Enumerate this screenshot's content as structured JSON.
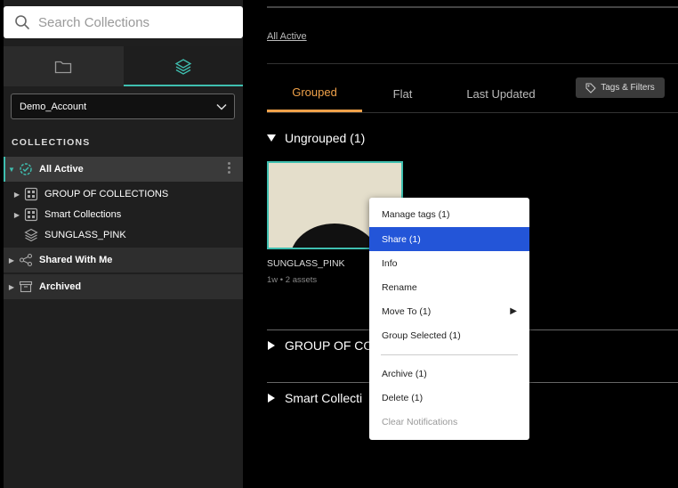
{
  "search": {
    "placeholder": "Search Collections"
  },
  "account": {
    "selected": "Demo_Account"
  },
  "sidebar": {
    "section_label": "COLLECTIONS",
    "items": [
      {
        "label": "All Active"
      },
      {
        "label": "GROUP OF COLLECTIONS"
      },
      {
        "label": "Smart Collections"
      },
      {
        "label": "SUNGLASS_PINK"
      },
      {
        "label": "Shared With Me"
      },
      {
        "label": "Archived"
      }
    ]
  },
  "main": {
    "breadcrumb": "All Active",
    "tabs": [
      {
        "label": "Grouped"
      },
      {
        "label": "Flat"
      },
      {
        "label": "Last Updated"
      }
    ],
    "tags_filters_label": "Tags & Filters",
    "groups": [
      {
        "label": "Ungrouped (1)"
      },
      {
        "label": "GROUP OF CO"
      },
      {
        "label": "Smart Collecti"
      }
    ],
    "card": {
      "title": "SUNGLASS_PINK",
      "age": "1w",
      "assets": "2 assets"
    }
  },
  "context_menu": {
    "items": [
      {
        "label": "Manage tags (1)"
      },
      {
        "label": "Share (1)"
      },
      {
        "label": "Info"
      },
      {
        "label": "Rename"
      },
      {
        "label": "Move To (1)"
      },
      {
        "label": "Group Selected (1)"
      },
      {
        "label": "Archive (1)"
      },
      {
        "label": "Delete (1)"
      },
      {
        "label": "Clear Notifications"
      }
    ]
  },
  "colors": {
    "accent_teal": "#3fbfb0",
    "accent_orange": "#f0a24a",
    "menu_highlight": "#2355d8"
  }
}
